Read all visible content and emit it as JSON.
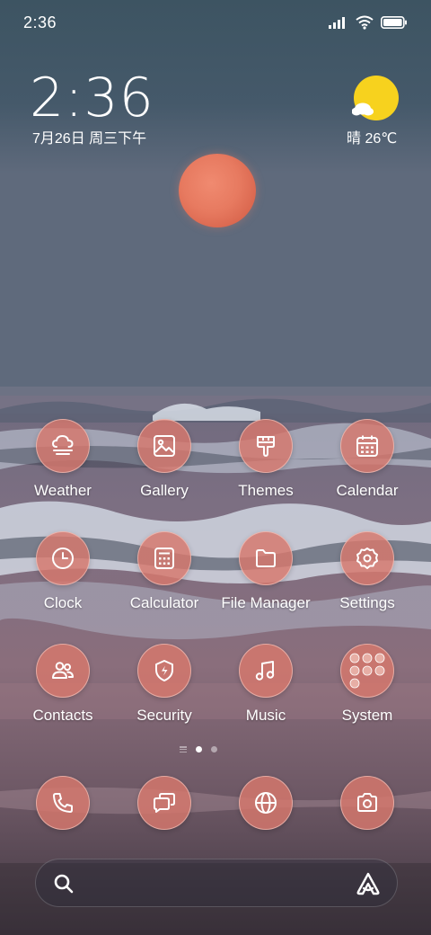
{
  "status_bar": {
    "time": "2:36",
    "signal_icon": "signal-icon",
    "wifi_icon": "wifi-icon",
    "battery_icon": "battery-icon"
  },
  "clock_widget": {
    "time": "2:36",
    "date": "7月26日 周三下午"
  },
  "weather_widget": {
    "icon": "sunny-partly-cloudy-icon",
    "text": "晴 26℃"
  },
  "apps": [
    {
      "label": "Weather",
      "icon": "weather-icon"
    },
    {
      "label": "Gallery",
      "icon": "gallery-icon"
    },
    {
      "label": "Themes",
      "icon": "themes-icon"
    },
    {
      "label": "Calendar",
      "icon": "calendar-icon"
    },
    {
      "label": "Clock",
      "icon": "clock-icon"
    },
    {
      "label": "Calculator",
      "icon": "calculator-icon"
    },
    {
      "label": "File Manager",
      "icon": "folder-icon"
    },
    {
      "label": "Settings",
      "icon": "gear-icon"
    },
    {
      "label": "Contacts",
      "icon": "contacts-icon"
    },
    {
      "label": "Security",
      "icon": "shield-icon"
    },
    {
      "label": "Music",
      "icon": "music-note-icon"
    },
    {
      "label": "System",
      "icon": "folder-grid-icon"
    }
  ],
  "page_indicator": {
    "pages": 2,
    "current": 1
  },
  "dock": [
    {
      "name": "phone",
      "icon": "phone-icon"
    },
    {
      "name": "messages",
      "icon": "message-icon"
    },
    {
      "name": "browser",
      "icon": "globe-icon"
    },
    {
      "name": "camera",
      "icon": "camera-icon"
    }
  ],
  "search_bar": {
    "left_icon": "search-icon",
    "right_icon": "assistant-icon"
  },
  "colors": {
    "icon_fill": "#d7786c",
    "sun": "#f7d21e",
    "moon": "#e77a60",
    "sky": "#3f5566"
  }
}
